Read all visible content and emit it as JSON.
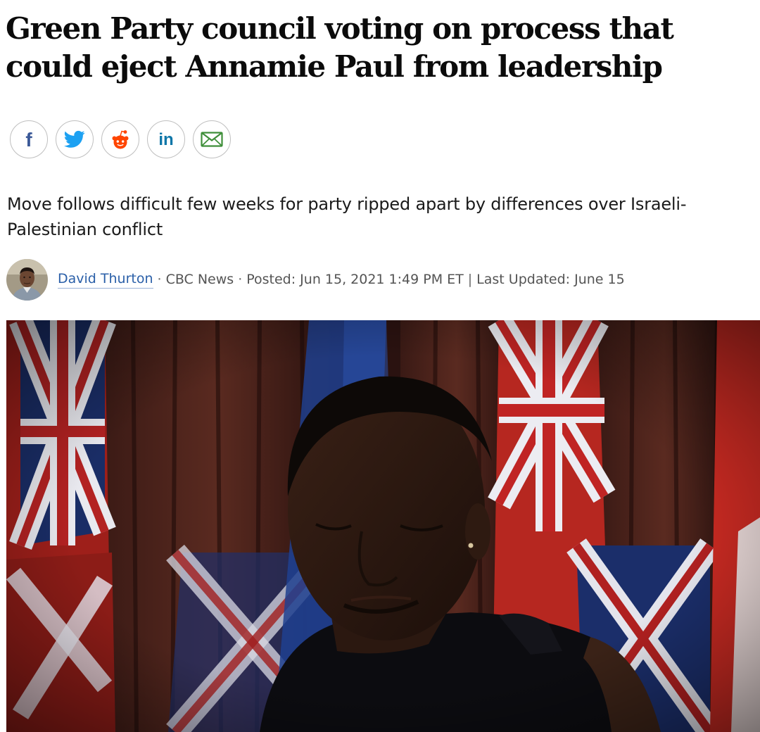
{
  "article": {
    "headline": "Green Party council voting on process that could eject Annamie Paul from leadership",
    "deck": "Move follows difficult few weeks for party ripped apart by differences over Israeli-Palestinian conflict"
  },
  "share": {
    "buttons": [
      {
        "name": "facebook",
        "icon": "facebook-icon",
        "color": "#3b5998"
      },
      {
        "name": "twitter",
        "icon": "twitter-icon",
        "color": "#1da1f2"
      },
      {
        "name": "reddit",
        "icon": "reddit-icon",
        "color": "#ff4500"
      },
      {
        "name": "linkedin",
        "icon": "linkedin-icon",
        "color": "#0e76a8"
      },
      {
        "name": "email",
        "icon": "email-icon",
        "color": "#3f8f3a"
      }
    ]
  },
  "byline": {
    "author": "David Thurton",
    "outlet": "CBC News",
    "posted": "Posted: Jun 15, 2021 1:49 PM ET",
    "divider": "|",
    "updated": "Last Updated: June 15",
    "dot": "·"
  },
  "colors": {
    "link": "#2a5fa8",
    "headline": "#0b0b0b",
    "meta": "#545454"
  }
}
